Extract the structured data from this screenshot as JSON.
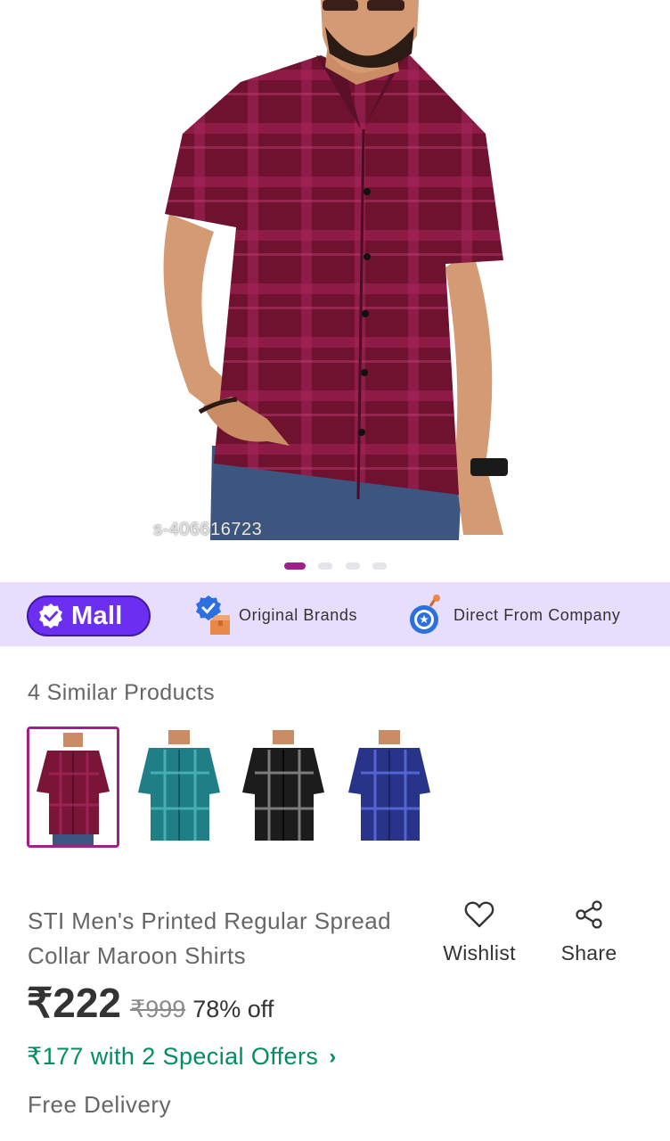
{
  "product_image": {
    "watermark": "s-406616723",
    "carousel_count": 4,
    "carousel_active": 0
  },
  "mall_strip": {
    "mall_label": "Mall",
    "items": [
      {
        "label": "Original Brands",
        "icon": "verified-box-icon"
      },
      {
        "label": "Direct From Company",
        "icon": "company-badge-icon"
      }
    ]
  },
  "similar": {
    "title": "4 Similar Products",
    "items": [
      {
        "color": "#7a1538",
        "selected": true
      },
      {
        "color": "#1f7e86",
        "selected": false
      },
      {
        "color": "#1c1c1c",
        "selected": false
      },
      {
        "color": "#28348a",
        "selected": false
      }
    ]
  },
  "product": {
    "title": "STI Men's Printed Regular Spread Collar Maroon Shirts",
    "price": "₹222",
    "mrp": "₹999",
    "discount": "78% off",
    "offer": "₹177 with 2 Special Offers",
    "delivery": "Free Delivery"
  },
  "actions": {
    "wishlist": "Wishlist",
    "share": "Share"
  },
  "colors": {
    "brand": "#9f2089",
    "mall_purple": "#6c2ff2",
    "strip_bg": "#e7ddfd",
    "offer_green": "#038d63"
  }
}
